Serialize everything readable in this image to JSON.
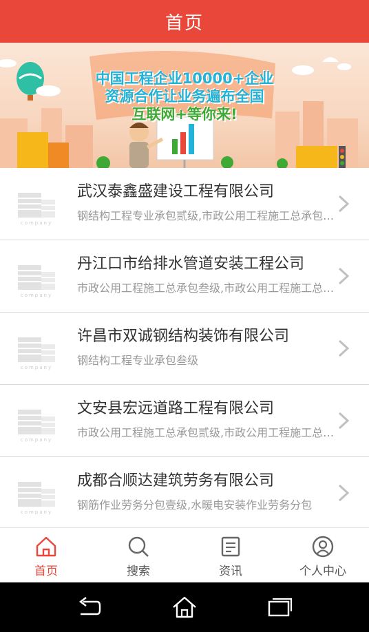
{
  "header": {
    "title": "首页"
  },
  "banner": {
    "line1": "中国工程企业10000+企业",
    "line2": "资源合作让业务遍布全国",
    "line3": "互联网+等你来!"
  },
  "companies": [
    {
      "name": "武汉泰鑫盛建设工程有限公司",
      "desc": "钢结构工程专业承包贰级,市政公用工程施工总承包叁级"
    },
    {
      "name": "丹江口市给排水管道安装工程公司",
      "desc": "市政公用工程施工总承包叁级,市政公用工程施工总承包"
    },
    {
      "name": "许昌市双诚钢结构装饰有限公司",
      "desc": "钢结构工程专业承包叁级"
    },
    {
      "name": "文安县宏远道路工程有限公司",
      "desc": "市政公用工程施工总承包贰级,市政公用工程施工总承包"
    },
    {
      "name": "成都合顺达建筑劳务有限公司",
      "desc": "钢筋作业劳务分包壹级,水暖电安装作业劳务分包"
    }
  ],
  "logo_text": "company",
  "tabs": [
    {
      "label": "首页",
      "icon": "home-icon",
      "active": true
    },
    {
      "label": "搜索",
      "icon": "search-icon",
      "active": false
    },
    {
      "label": "资讯",
      "icon": "news-icon",
      "active": false
    },
    {
      "label": "个人中心",
      "icon": "user-icon",
      "active": false
    }
  ],
  "colors": {
    "accent": "#e8473a",
    "text": "#333333",
    "muted": "#999999"
  }
}
